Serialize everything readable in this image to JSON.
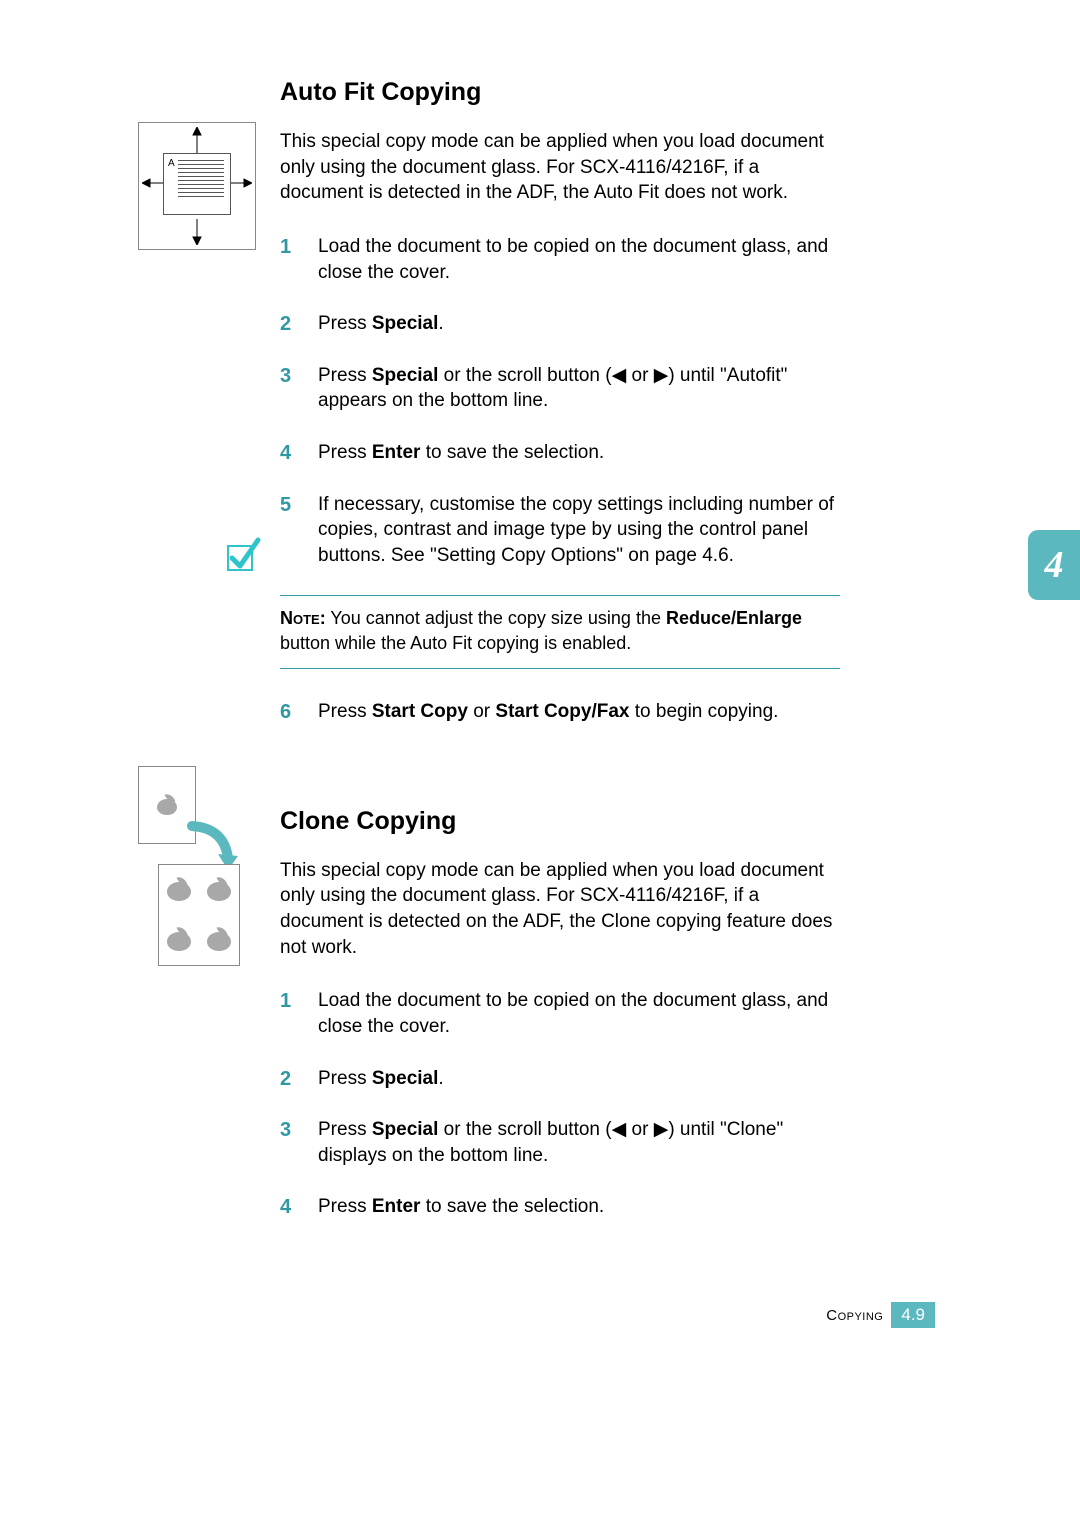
{
  "chapter_tab": "4",
  "footer": {
    "label": "Copying",
    "page": "4.9"
  },
  "section1": {
    "title": "Auto Fit Copying",
    "intro": "This special copy mode can be applied when you load document only using the document glass. For SCX-4116/4216F, if a document is detected in the ADF, the Auto Fit does not work.",
    "steps": [
      {
        "n": "1",
        "html": "Load the document to be copied on the document glass, and close the cover."
      },
      {
        "n": "2",
        "html": "Press <b>Special</b>."
      },
      {
        "n": "3",
        "html": "Press <b>Special</b> or the scroll button (<span class='tri'>◀</span> or <span class='tri'>▶</span>) until \"Autofit\" appears on the bottom line."
      },
      {
        "n": "4",
        "html": "Press <b>Enter</b> to save the selection."
      },
      {
        "n": "5",
        "html": "If necessary, customise the copy settings including number of copies, contrast and image type by using the control panel buttons. See \"Setting Copy Options\" on page 4.6."
      }
    ],
    "note_html": "<span class='note-label'>Note:</span> You cannot adjust the copy size using the <b>Reduce/Enlarge</b> button while the Auto Fit copying is enabled.",
    "steps_after_note": [
      {
        "n": "6",
        "html": "Press <b>Start Copy</b> or <b>Start Copy/Fax</b> to begin copying."
      }
    ],
    "figure_label": "A"
  },
  "section2": {
    "title": "Clone Copying",
    "intro": "This special copy mode can be applied when you load document only using the document glass. For SCX-4116/4216F, if a document is detected on the ADF, the Clone copying feature does not work.",
    "steps": [
      {
        "n": "1",
        "html": "Load the document to be copied on the document glass, and close the cover."
      },
      {
        "n": "2",
        "html": "Press <b>Special</b>."
      },
      {
        "n": "3",
        "html": "Press <b>Special</b> or the scroll button (<span class='tri'>◀</span> or <span class='tri'>▶</span>) until \"Clone\" displays on the bottom line."
      },
      {
        "n": "4",
        "html": "Press <b>Enter</b> to save the selection."
      }
    ]
  }
}
